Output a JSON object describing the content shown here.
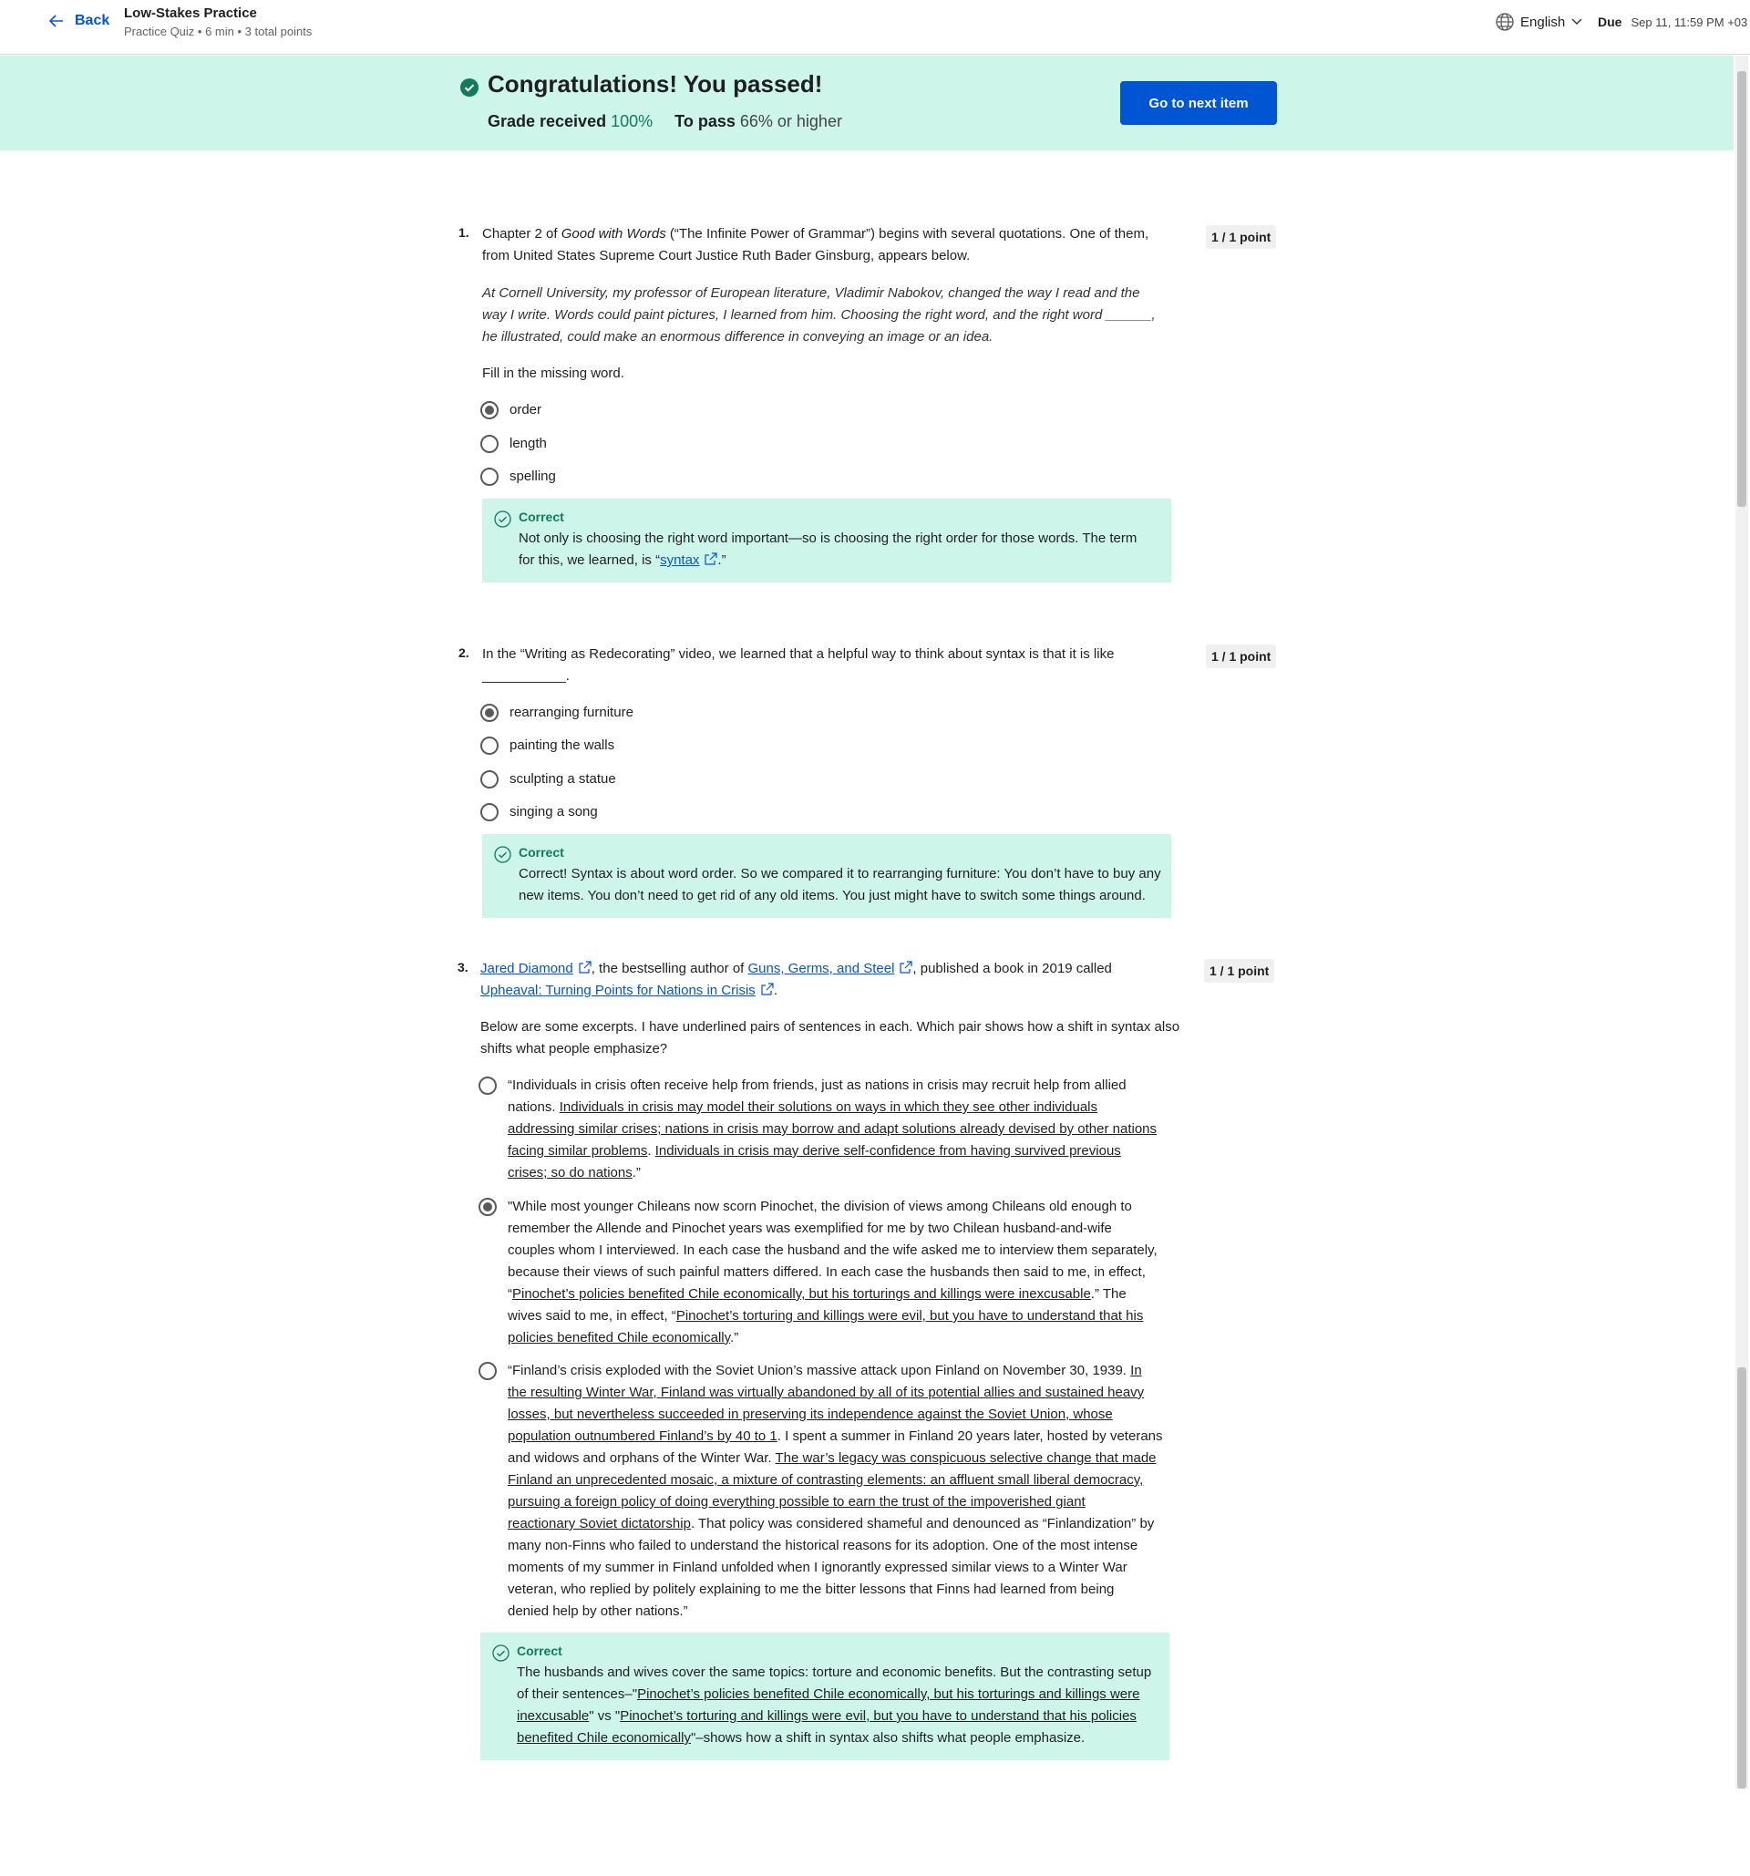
{
  "header": {
    "back_label": "Back",
    "title": "Low-Stakes Practice",
    "subtitle": "Practice Quiz • 6 min • 3 total points",
    "language": "English",
    "due_label": "Due",
    "due_date": "Sep 11, 11:59 PM +03"
  },
  "banner": {
    "heading": "Congratulations! You passed!",
    "grade_label": "Grade received",
    "grade_value": "100%",
    "pass_label": "To pass",
    "pass_value": "66% or higher",
    "next_button": "Go to next item"
  },
  "colors": {
    "accent": "#0056d2",
    "success_bg": "#cdf5ea",
    "success_text": "#137a5c"
  },
  "q1": {
    "number": "1.",
    "points": "1 / 1 point",
    "stem_a": "Chapter 2 of ",
    "stem_book": "Good with Words",
    "stem_b": " (“The Infinite Power of Grammar”) begins with several quotations. One of them,",
    "stem_c": "from United States Supreme Court Justice Ruth Bader Ginsburg, appears below.",
    "quote_1": " At Cornell University, my professor of European literature,  Vladimir  Nabokov, changed the way I read and the",
    "quote_2": "way I write. Words could paint pictures, I learned from him. Choosing the right word, and the right word ______,",
    "quote_3": "he illustrated, could make an enormous difference in conveying an image or an idea.",
    "prompt": "Fill in the missing word.",
    "options": [
      "order",
      "length",
      "spelling"
    ],
    "feedback_title": "Correct",
    "feedback_1": "Not only is choosing the right word important—so is choosing the right order for those words. The term",
    "feedback_2a": "for this, we learned, is “",
    "feedback_link": "syntax",
    "feedback_2b": ".”"
  },
  "q2": {
    "number": "2.",
    "points": "1 / 1 point",
    "stem_1": "In the “Writing as Redecorating” video, we learned that a helpful way to think about syntax is that it is like",
    "stem_2": "___________.",
    "options": [
      "rearranging furniture",
      "painting the walls",
      "sculpting a statue",
      "singing a song"
    ],
    "feedback_title": "Correct",
    "feedback_1": "Correct! Syntax is about word order. So we compared it to rearranging furniture: You don’t have to buy any",
    "feedback_2": "new items. You don’t need to get rid of any old items. You just might have to switch some things around."
  },
  "q3": {
    "number": "3.",
    "points": "1 / 1 point",
    "link_author": "Jared Diamond",
    "stem_a": ", the bestselling author of ",
    "link_book1": "Guns, Germs, and Steel",
    "stem_b": ", published a book in 2019 called",
    "link_book2": "Upheaval: Turning Points for Nations in Crisis",
    "stem_c": ".",
    "intro_1": "Below are some excerpts. I have underlined pairs of sentences in each. Which pair shows how a shift in syntax also",
    "intro_2": "shifts what people emphasize?",
    "opt1": {
      "l1": "“Individuals in crisis often receive help from friends, just as nations in crisis may recruit help from allied",
      "l2a": "nations. ",
      "l2u": "Individuals in crisis may model their solutions on ways in which they see other individuals",
      "l3u": "addressing similar crises; nations in crisis may borrow and adapt solutions already devised by other nations",
      "l4u1": "facing similar problems",
      "l4a": ". ",
      "l4u2": "Individuals in crisis may derive self-confidence from having survived previous",
      "l5u": "crises; so do nations",
      "l5a": ".”"
    },
    "opt2": {
      "l1": "\"While most younger Chileans now scorn Pinochet, the division of views among Chileans old enough to",
      "l2": "remember the Allende and Pinochet years was exemplified for me by two Chilean husband-and-wife",
      "l3": "couples whom I interviewed. In each case the husband and the wife asked me to interview them separately,",
      "l4": "because their views of such painful matters differed. In each case the husbands then said to me, in effect,",
      "l5a": "“",
      "l5u": "Pinochet’s policies benefited Chile economically, but his torturings and killings were inexcusable",
      "l5b": ".” The",
      "l6a": "wives said to me, in effect, “",
      "l6u": "Pinochet’s torturing and killings were evil, but you have to understand that his",
      "l7u": "policies benefited Chile economically",
      "l7a": ".”"
    },
    "opt3": {
      "l1a": "“Finland’s crisis exploded with the Soviet Union’s massive attack upon Finland on November 30, 1939. ",
      "l1u": "In",
      "l2u": "the resulting Winter War, Finland was virtually abandoned by all of its potential allies and sustained heavy",
      "l3u": "losses, but nevertheless succeeded in preserving its independence against the Soviet Union, whose",
      "l4u": "population outnumbered Finland’s by 40 to 1",
      "l4a": ". I spent a summer in Finland 20 years later, hosted by veterans",
      "l5a": "and widows and orphans of the Winter War. ",
      "l5u": "The war’s legacy was conspicuous selective change that made",
      "l6u": "Finland an unprecedented mosaic, a mixture of contrasting elements: an affluent small liberal democracy,",
      "l7u": "pursuing a foreign policy of doing everything possible to earn the trust of the impoverished giant",
      "l8u": "reactionary Soviet dictatorship",
      "l8a": ". That policy was considered shameful and denounced as “Finlandization” by",
      "l9": "many non-Finns who failed to understand the historical reasons for its adoption. One of the most intense",
      "l10": "moments of my summer in Finland unfolded when I ignorantly expressed similar views to a Winter War",
      "l11": "veteran, who replied by politely explaining to me the bitter lessons that Finns had learned from being",
      "l12": "denied help by other nations.”"
    },
    "feedback_title": "Correct",
    "feedback_1": "The husbands and wives cover the same topics: torture and economic benefits. But the contrasting setup",
    "feedback_2a": "of their sentences–\"",
    "feedback_2u": "Pinochet’s policies benefited Chile economically, but his torturings and killings were",
    "feedback_3u": "inexcusable",
    "feedback_3a": "\" vs \"",
    "feedback_3u2": "Pinochet’s torturing and killings were evil, but you have to understand that his policies",
    "feedback_4u": "benefited Chile economically",
    "feedback_4a": "\"–shows how a shift in syntax also shifts what people emphasize."
  }
}
